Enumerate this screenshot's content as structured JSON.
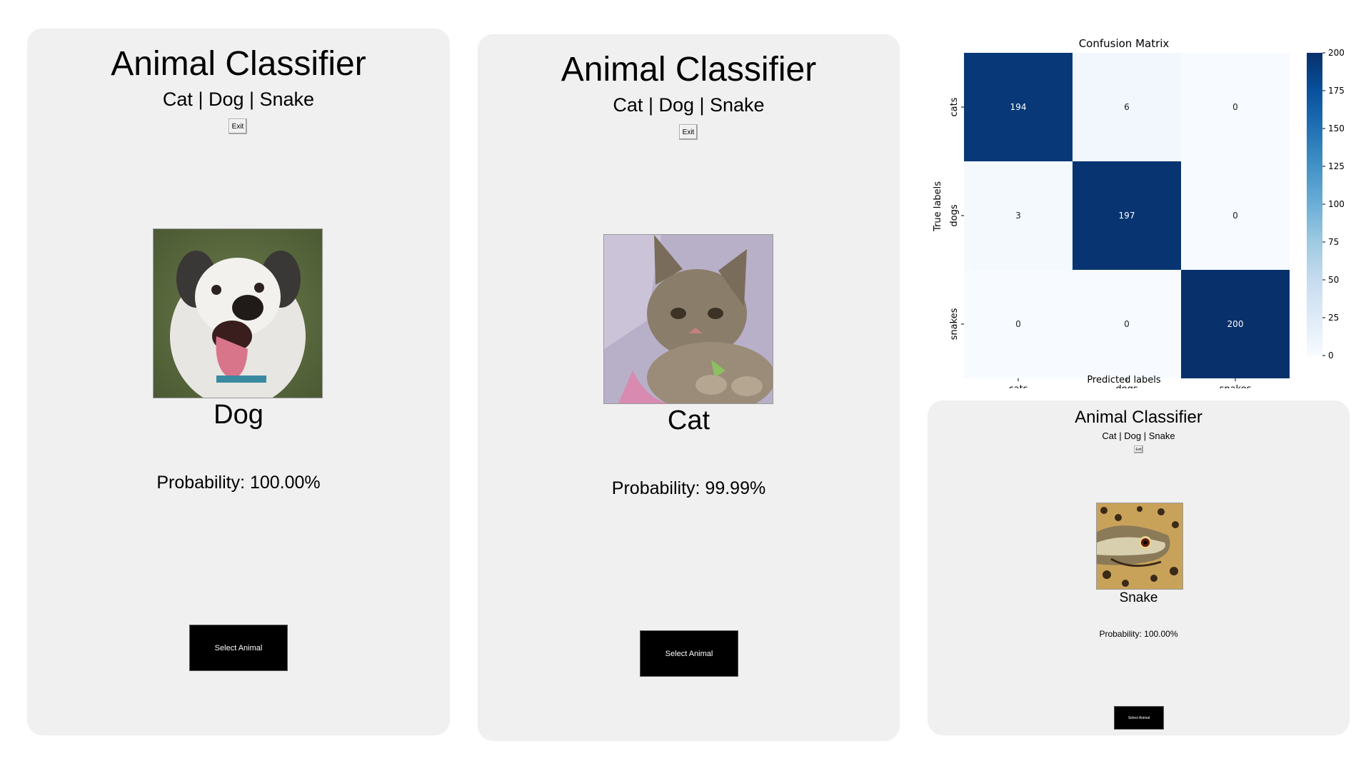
{
  "apps": [
    {
      "title": "Animal Classifier",
      "subtitle": "Cat | Dog | Snake",
      "exit_label": "Exit",
      "result_label": "Dog",
      "probability_text": "Probability: 100.00%",
      "select_label": "Select Animal",
      "image_subject": "dog"
    },
    {
      "title": "Animal Classifier",
      "subtitle": "Cat | Dog | Snake",
      "exit_label": "Exit",
      "result_label": "Cat",
      "probability_text": "Probability: 99.99%",
      "select_label": "Select Animal",
      "image_subject": "cat"
    },
    {
      "title": "Animal Classifier",
      "subtitle": "Cat | Dog | Snake",
      "exit_label": "Exit",
      "result_label": "Snake",
      "probability_text": "Probability: 100.00%",
      "select_label": "Select Animal",
      "image_subject": "snake"
    }
  ],
  "chart_data": {
    "type": "heatmap",
    "title": "Confusion Matrix",
    "xlabel": "Predicted labels",
    "ylabel": "True labels",
    "x_categories": [
      "cats",
      "dogs",
      "snakes"
    ],
    "y_categories": [
      "cats",
      "dogs",
      "snakes"
    ],
    "values": [
      [
        194,
        6,
        0
      ],
      [
        3,
        197,
        0
      ],
      [
        0,
        0,
        200
      ]
    ],
    "colorbar_ticks": [
      0,
      25,
      50,
      75,
      100,
      125,
      150,
      175,
      200
    ],
    "vmin": 0,
    "vmax": 200,
    "colormap": "Blues",
    "color_low": "#f7fbff",
    "color_high": "#08306b"
  },
  "colors": {
    "panel_bg": "#f0f0f0",
    "select_bg": "#000000",
    "select_text": "#ffffff"
  }
}
